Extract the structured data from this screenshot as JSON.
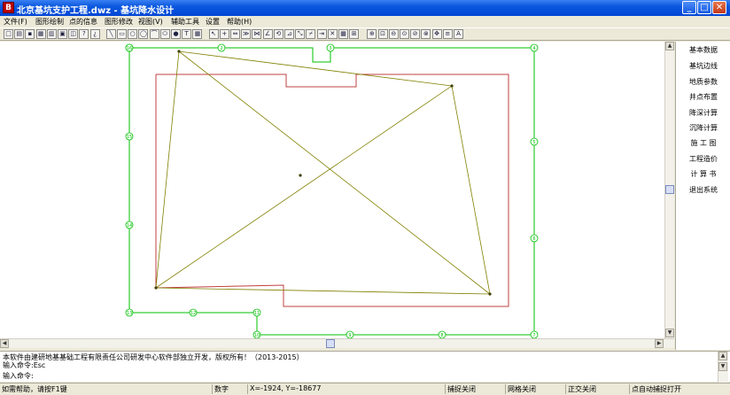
{
  "window": {
    "app_icon_label": "B",
    "title": "北京基坑支护工程.dwz - 基坑降水设计",
    "min_glyph": "_",
    "max_glyph": "□",
    "close_glyph": "✕"
  },
  "menu": [
    "文件(F)",
    "图形绘制",
    "点的信息",
    "图形修改",
    "视图(V)",
    "辅助工具",
    "设置",
    "帮助(H)"
  ],
  "toolbar": [
    {
      "name": "new-icon",
      "glyph": "□"
    },
    {
      "name": "open-icon",
      "glyph": "▤"
    },
    {
      "name": "save-icon",
      "glyph": "▪"
    },
    {
      "name": "print-preview-icon",
      "glyph": "▦"
    },
    {
      "name": "print-icon",
      "glyph": "▥"
    },
    {
      "name": "page-setup-icon",
      "glyph": "▣"
    },
    {
      "name": "preview-icon",
      "glyph": "◫"
    },
    {
      "name": "help-icon",
      "glyph": "?"
    },
    {
      "name": "context-help-icon",
      "glyph": "¿"
    },
    {
      "name": "line-icon",
      "glyph": "╲"
    },
    {
      "name": "rectangle-icon",
      "glyph": "▭"
    },
    {
      "name": "circle-icon",
      "glyph": "○"
    },
    {
      "name": "circle2-icon",
      "glyph": "◯"
    },
    {
      "name": "arc-icon",
      "glyph": "⌒"
    },
    {
      "name": "ellipse-icon",
      "glyph": "⬭"
    },
    {
      "name": "sphere-icon",
      "glyph": "●"
    },
    {
      "name": "text-icon",
      "glyph": "T"
    },
    {
      "name": "table-icon",
      "glyph": "▦"
    },
    {
      "name": "pointer-icon",
      "glyph": "↖"
    },
    {
      "name": "cross-icon",
      "glyph": "+"
    },
    {
      "name": "move-icon",
      "glyph": "⇔"
    },
    {
      "name": "copy-icon",
      "glyph": "≫"
    },
    {
      "name": "mirror-icon",
      "glyph": "⋈"
    },
    {
      "name": "angle-icon",
      "glyph": "∠"
    },
    {
      "name": "rotate-icon",
      "glyph": "⟲"
    },
    {
      "name": "scale-icon",
      "glyph": "⊿"
    },
    {
      "name": "stretch-icon",
      "glyph": "⤡"
    },
    {
      "name": "trim-icon",
      "glyph": "⌿"
    },
    {
      "name": "extend-icon",
      "glyph": "⇥"
    },
    {
      "name": "break-icon",
      "glyph": "✕"
    },
    {
      "name": "array-icon",
      "glyph": "▦"
    },
    {
      "name": "explode-icon",
      "glyph": "⊞"
    },
    {
      "name": "zoom-in-icon",
      "glyph": "⊕"
    },
    {
      "name": "zoom-window-icon",
      "glyph": "⊡"
    },
    {
      "name": "zoom-out-icon",
      "glyph": "⊖"
    },
    {
      "name": "zoom-all-icon",
      "glyph": "⊙"
    },
    {
      "name": "zoom-prev-icon",
      "glyph": "⊘"
    },
    {
      "name": "zoom-extents-icon",
      "glyph": "⊗"
    },
    {
      "name": "pan-icon",
      "glyph": "✥"
    },
    {
      "name": "layer-icon",
      "glyph": "≡"
    },
    {
      "name": "font-icon",
      "glyph": "A"
    }
  ],
  "right_panel": [
    "基本数据",
    "基坑边线",
    "地质参数",
    "井点布置",
    "降深计算",
    "沉降计算",
    "施 工 图",
    "工程造价",
    "计 算 书",
    "退出系统"
  ],
  "drawing": {
    "grid_markers": [
      "1",
      "2",
      "3",
      "4",
      "5",
      "6",
      "7",
      "8",
      "9",
      "10",
      "11",
      "12",
      "13",
      "14",
      "15",
      "16"
    ]
  },
  "command": {
    "line1": "本软件由建研地基基础工程有限责任公司研发中心软件部独立开发，版权所有！（2013-2015）",
    "line2": "输入命令:Esc",
    "line3": "输入命令:"
  },
  "status": {
    "help": "如需帮助，请按F1键",
    "mode": "数字",
    "coords": "X=-1924, Y=-18677",
    "snap": "捕捉关闭",
    "grid": "网格关闭",
    "ortho": "正交关闭",
    "auto_snap": "点自动捕捉打开"
  },
  "colors": {
    "pit_outline": "#c04040",
    "well_line": "#00c000",
    "diagonal": "#808000",
    "title_bar": "#0a58de"
  }
}
